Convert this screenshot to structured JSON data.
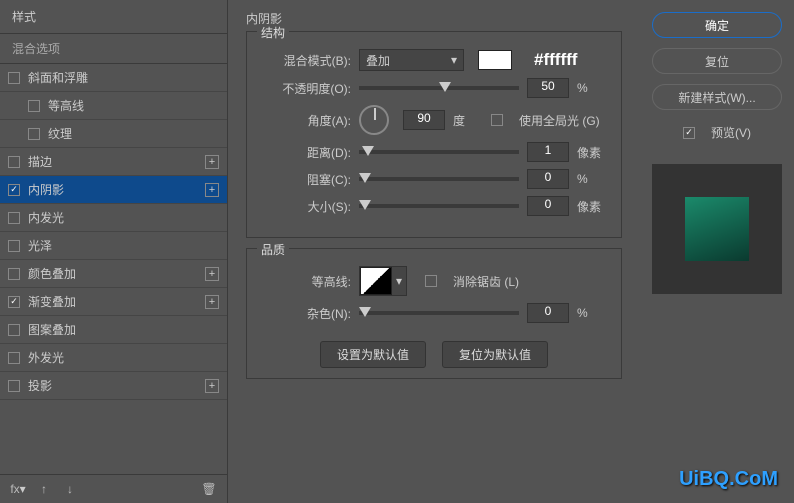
{
  "left": {
    "head": "样式",
    "sub": "混合选项",
    "items": [
      {
        "label": "斜面和浮雕",
        "checked": false,
        "plus": false,
        "indent": false
      },
      {
        "label": "等高线",
        "checked": false,
        "plus": false,
        "indent": true
      },
      {
        "label": "纹理",
        "checked": false,
        "plus": false,
        "indent": true
      },
      {
        "label": "描边",
        "checked": false,
        "plus": true,
        "indent": false
      },
      {
        "label": "内阴影",
        "checked": true,
        "plus": true,
        "indent": false,
        "sel": true
      },
      {
        "label": "内发光",
        "checked": false,
        "plus": false,
        "indent": false
      },
      {
        "label": "光泽",
        "checked": false,
        "plus": false,
        "indent": false
      },
      {
        "label": "颜色叠加",
        "checked": false,
        "plus": true,
        "indent": false
      },
      {
        "label": "渐变叠加",
        "checked": true,
        "plus": true,
        "indent": false
      },
      {
        "label": "图案叠加",
        "checked": false,
        "plus": false,
        "indent": false
      },
      {
        "label": "外发光",
        "checked": false,
        "plus": false,
        "indent": false
      },
      {
        "label": "投影",
        "checked": false,
        "plus": true,
        "indent": false
      }
    ]
  },
  "mid": {
    "title": "内阴影",
    "structure": {
      "legend": "结构",
      "blend": {
        "label": "混合模式(B):",
        "value": "叠加",
        "color": "#ffffff"
      },
      "opacity": {
        "label": "不透明度(O):",
        "value": "50",
        "unit": "%",
        "thumb": 50
      },
      "angle": {
        "label": "角度(A):",
        "value": "90",
        "unit": "度",
        "global": "使用全局光 (G)"
      },
      "distance": {
        "label": "距离(D):",
        "value": "1",
        "unit": "像素",
        "thumb": 2
      },
      "choke": {
        "label": "阻塞(C):",
        "value": "0",
        "unit": "%",
        "thumb": 0
      },
      "size": {
        "label": "大小(S):",
        "value": "0",
        "unit": "像素",
        "thumb": 0
      }
    },
    "quality": {
      "legend": "品质",
      "contour": {
        "label": "等高线:",
        "aa": "消除锯齿 (L)"
      },
      "noise": {
        "label": "杂色(N):",
        "value": "0",
        "unit": "%",
        "thumb": 0
      }
    },
    "buttons": {
      "default": "设置为默认值",
      "reset": "复位为默认值"
    }
  },
  "right": {
    "ok": "确定",
    "cancel": "复位",
    "newstyle": "新建样式(W)...",
    "preview": "预览(V)"
  },
  "logo": "UiBQ.CoM"
}
